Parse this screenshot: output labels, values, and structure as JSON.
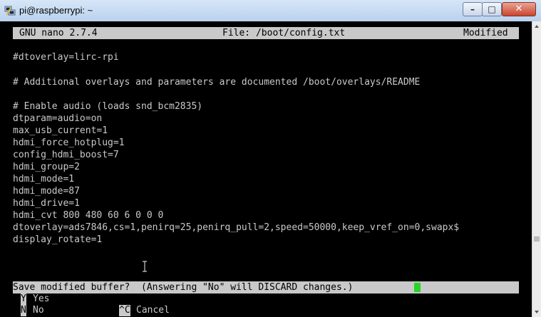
{
  "window": {
    "title": "pi@raspberrypi: ~",
    "buttons": {
      "minimize": "–",
      "maximize": "□",
      "close": "✕"
    }
  },
  "nano": {
    "version": "GNU nano 2.7.4",
    "file": "File: /boot/config.txt",
    "status": "Modified"
  },
  "lines": [
    "#dtoverlay=lirc-rpi",
    "",
    "# Additional overlays and parameters are documented /boot/overlays/README",
    "",
    "# Enable audio (loads snd_bcm2835)",
    "dtparam=audio=on",
    "max_usb_current=1",
    "hdmi_force_hotplug=1",
    "config_hdmi_boost=7",
    "hdmi_group=2",
    "hdmi_mode=1",
    "hdmi_mode=87",
    "hdmi_drive=1",
    "hdmi_cvt 800 480 60 6 0 0 0",
    "dtoverlay=ads7846,cs=1,penirq=25,penirq_pull=2,speed=50000,keep_vref_on=0,swapx$",
    "display_rotate=1"
  ],
  "prompt": {
    "question": "Save modified buffer?  (Answering \"No\" will DISCARD changes.) ",
    "options": [
      {
        "key": "Y",
        "label": "Yes"
      },
      {
        "key": "N",
        "label": "No"
      },
      {
        "key": "^C",
        "label": "Cancel"
      }
    ]
  }
}
